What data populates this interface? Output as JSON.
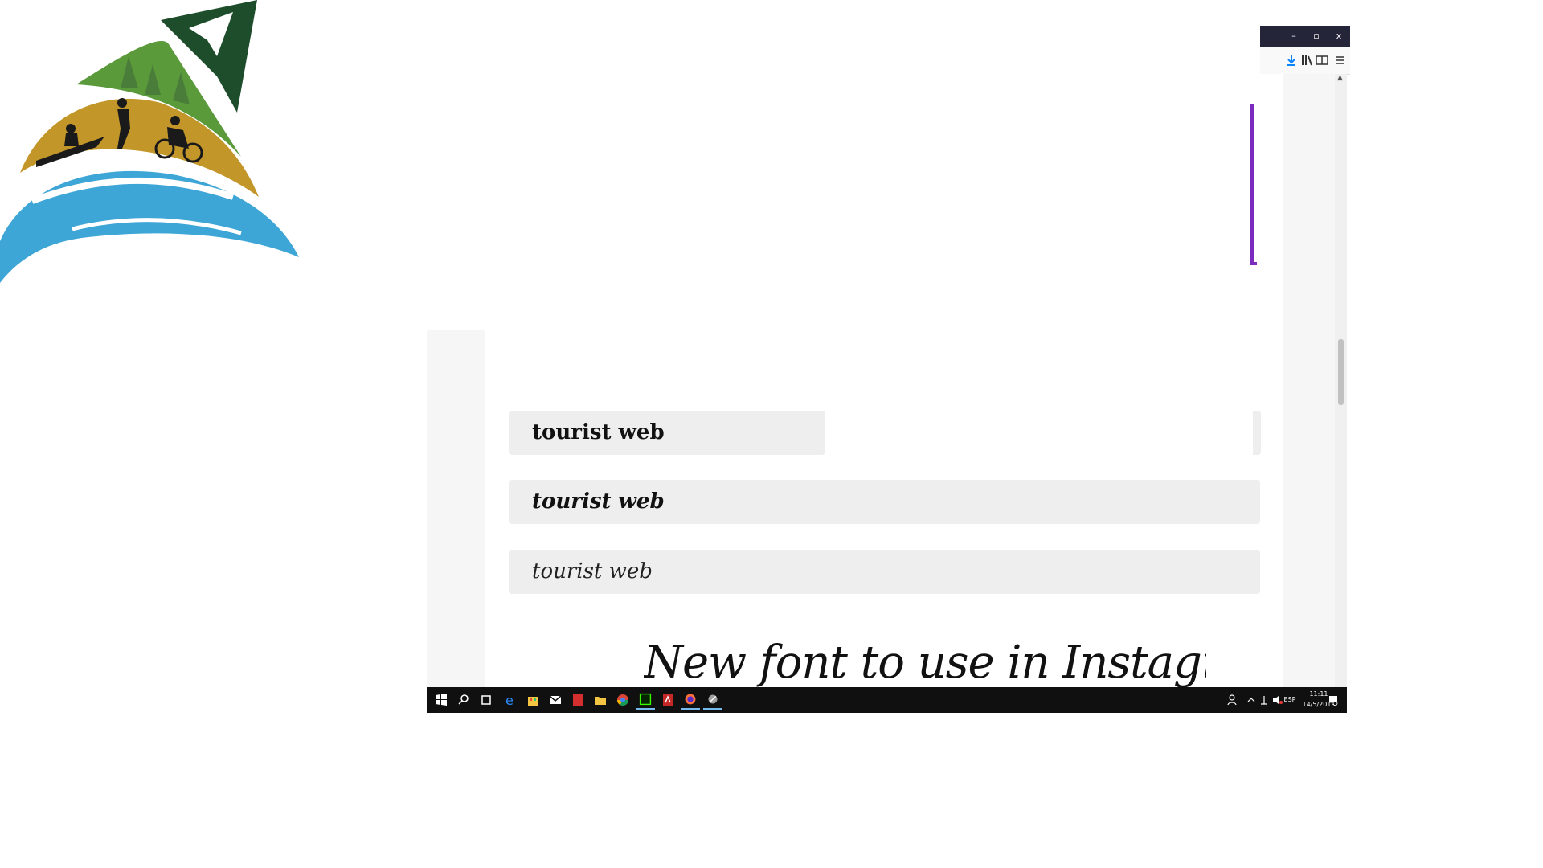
{
  "window": {
    "minimize_label": "–",
    "maximize_label": "▫",
    "close_label": "x"
  },
  "samples": [
    {
      "text": "tourist web",
      "style": "bold"
    },
    {
      "text": "tourist web",
      "style": "bold-italic"
    },
    {
      "text": "tourist web",
      "style": "italic"
    }
  ],
  "heading": "New font to use in Instagram",
  "toolbar_icons": [
    "download-icon",
    "library-icon",
    "reader-view-icon",
    "menu-icon"
  ],
  "taskbar": {
    "icons": [
      "windows-start-icon",
      "search-icon",
      "task-view-icon",
      "edge-icon",
      "store-icon",
      "mail-icon",
      "acrobat-icon",
      "file-explorer-icon",
      "chrome-icon",
      "dreamweaver-icon",
      "pdf-reader-icon",
      "firefox-icon",
      "app-icon"
    ],
    "time": "11:11",
    "date": "14/5/2019",
    "language": "ESP"
  },
  "colors": {
    "sample_bg": "#eeeeee",
    "accent_purple": "#7b2cbf",
    "titlebar": "#25253a",
    "taskbar": "#101010"
  }
}
